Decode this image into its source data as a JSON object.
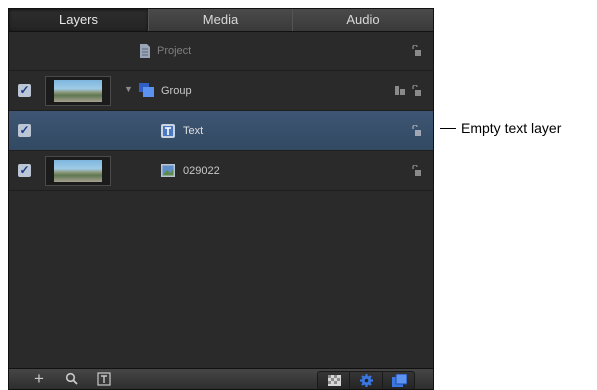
{
  "tabs": [
    {
      "label": "Layers",
      "selected": true
    },
    {
      "label": "Media",
      "selected": false
    },
    {
      "label": "Audio",
      "selected": false
    }
  ],
  "layers": [
    {
      "name": "Project",
      "type": "project",
      "checked": false,
      "thumbnail": false,
      "locked_icon": "unlock-icon"
    },
    {
      "name": "Group",
      "type": "group",
      "checked": true,
      "thumbnail": true,
      "expanded": true,
      "locked_icon": "unlock-icon"
    },
    {
      "name": "Text",
      "type": "text",
      "checked": true,
      "thumbnail": false,
      "selected": true,
      "locked_icon": "unlock-icon"
    },
    {
      "name": "029022",
      "type": "image",
      "checked": true,
      "thumbnail": true,
      "locked_icon": "unlock-icon"
    }
  ],
  "toolbar": {
    "left_icons": [
      "add-icon",
      "search-icon",
      "text-frame-icon"
    ],
    "right_icons": [
      "checker-mask-icon",
      "gear-icon",
      "layers-stack-icon"
    ]
  },
  "callout": {
    "text": "Empty text layer"
  },
  "colors": {
    "panel_bg": "#2a2a2a",
    "selected_row": "#3a5270",
    "accent_blue": "#3b77e0"
  }
}
